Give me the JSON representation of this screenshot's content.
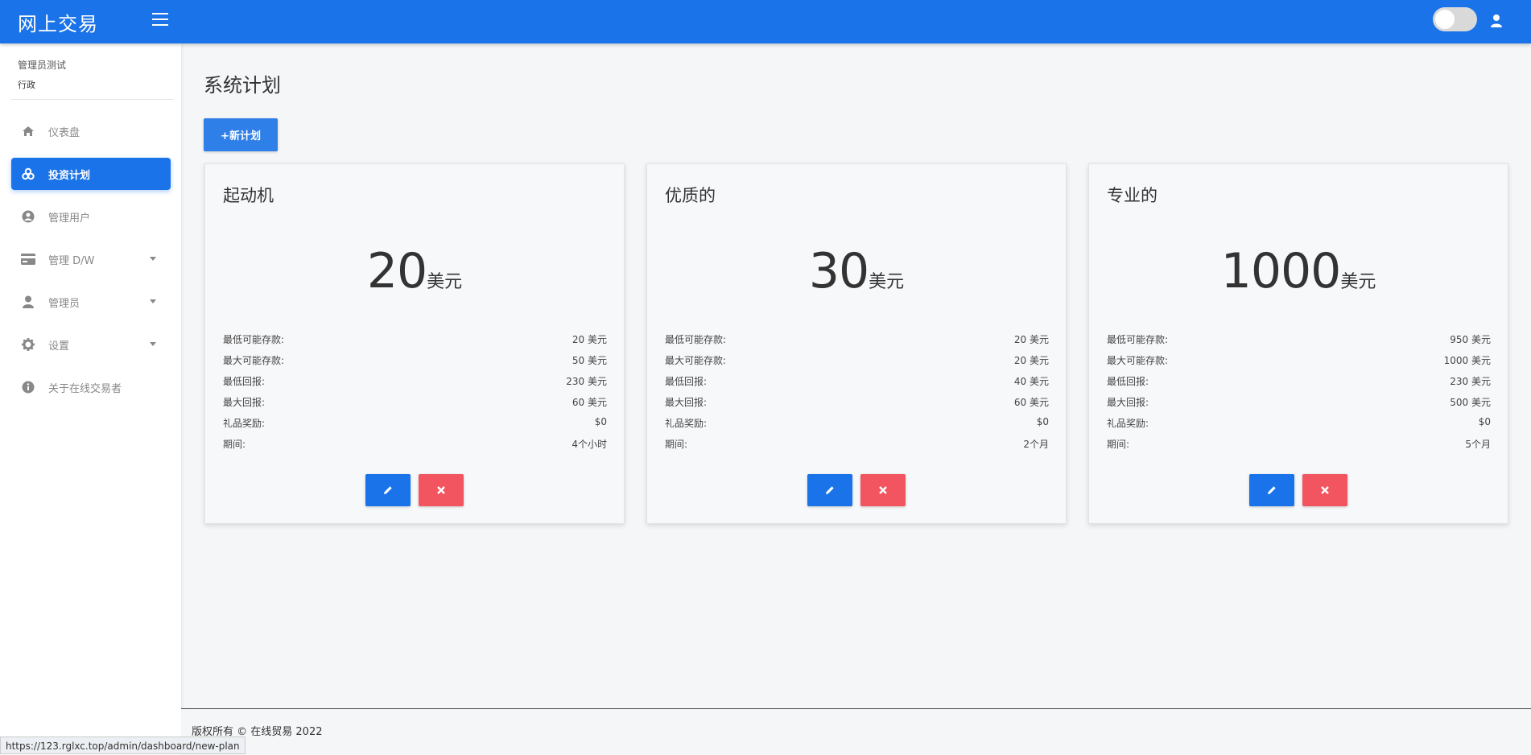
{
  "header": {
    "brand": "网上交易"
  },
  "sidebar": {
    "user_name": "管理员测试",
    "user_role": "行政",
    "items": [
      {
        "label": "仪表盘",
        "icon": "home-icon"
      },
      {
        "label": "投资计划",
        "icon": "cubes-icon"
      },
      {
        "label": "管理用户",
        "icon": "user-circle-icon"
      },
      {
        "label": "管理 D/W",
        "icon": "credit-card-icon"
      },
      {
        "label": "管理员",
        "icon": "user-icon"
      },
      {
        "label": "设置",
        "icon": "gear-icon"
      },
      {
        "label": "关于在线交易者",
        "icon": "info-icon"
      }
    ]
  },
  "main": {
    "page_title": "系统计划",
    "new_plan_label": "+新计划",
    "plans": [
      {
        "name": "起动机",
        "amount": "20",
        "currency": "美元",
        "rows": [
          {
            "label": "最低可能存款:",
            "value": "20 美元"
          },
          {
            "label": "最大可能存款:",
            "value": "50 美元"
          },
          {
            "label": "最低回报:",
            "value": "230 美元"
          },
          {
            "label": "最大回报:",
            "value": "60 美元"
          },
          {
            "label": "礼品奖励:",
            "value": "$0"
          },
          {
            "label": "期间:",
            "value": "4个小时"
          }
        ]
      },
      {
        "name": "优质的",
        "amount": "30",
        "currency": "美元",
        "rows": [
          {
            "label": "最低可能存款:",
            "value": "20 美元"
          },
          {
            "label": "最大可能存款:",
            "value": "20 美元"
          },
          {
            "label": "最低回报:",
            "value": "40 美元"
          },
          {
            "label": "最大回报:",
            "value": "60 美元"
          },
          {
            "label": "礼品奖励:",
            "value": "$0"
          },
          {
            "label": "期间:",
            "value": "2个月"
          }
        ]
      },
      {
        "name": "专业的",
        "amount": "1000",
        "currency": "美元",
        "rows": [
          {
            "label": "最低可能存款:",
            "value": "950 美元"
          },
          {
            "label": "最大可能存款:",
            "value": "1000 美元"
          },
          {
            "label": "最低回报:",
            "value": "230 美元"
          },
          {
            "label": "最大回报:",
            "value": "500 美元"
          },
          {
            "label": "礼品奖励:",
            "value": "$0"
          },
          {
            "label": "期间:",
            "value": "5个月"
          }
        ]
      }
    ]
  },
  "footer": {
    "copyright": "版权所有 © 在线贸易 2022"
  },
  "status_bar": {
    "url": "https://123.rglxc.top/admin/dashboard/new-plan"
  },
  "colors": {
    "primary": "#1a73e8",
    "danger": "#f2555f",
    "background": "#f5f6f8"
  }
}
